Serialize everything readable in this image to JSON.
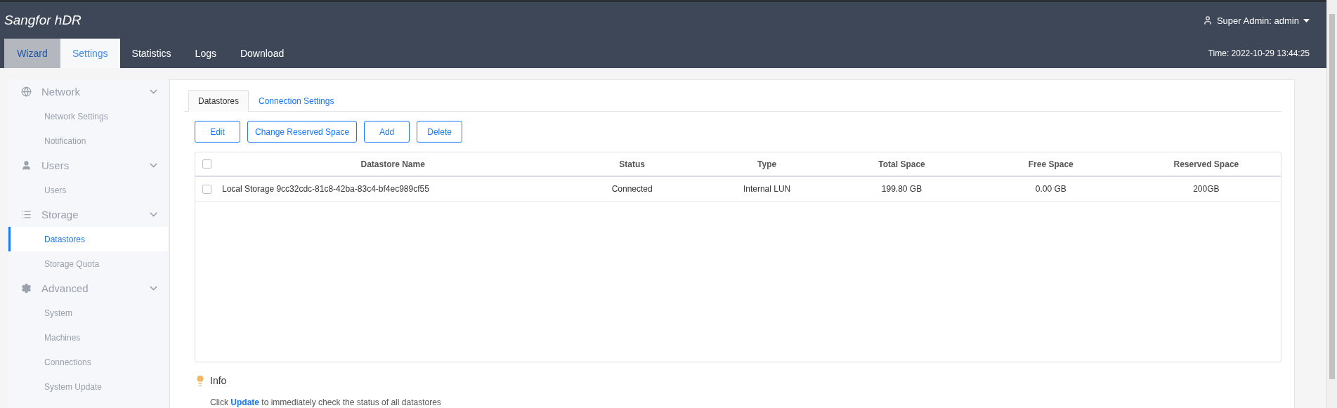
{
  "header": {
    "brand": "Sangfor hDR",
    "user": "Super Admin: admin",
    "time": "Time: 2022-10-29 13:44:25"
  },
  "nav_tabs": [
    {
      "label": "Wizard",
      "selected": false,
      "disabled": true
    },
    {
      "label": "Settings",
      "selected": true,
      "disabled": false
    },
    {
      "label": "Statistics",
      "selected": false,
      "disabled": false
    },
    {
      "label": "Logs",
      "selected": false,
      "disabled": false
    },
    {
      "label": "Download",
      "selected": false,
      "disabled": false
    }
  ],
  "sidebar": {
    "groups": [
      {
        "label": "Network",
        "expanded": true,
        "items": [
          {
            "label": "Network Settings",
            "selected": false
          },
          {
            "label": "Notification",
            "selected": false
          }
        ]
      },
      {
        "label": "Users",
        "expanded": true,
        "items": [
          {
            "label": "Users",
            "selected": false
          }
        ]
      },
      {
        "label": "Storage",
        "expanded": true,
        "items": [
          {
            "label": "Datastores",
            "selected": true
          },
          {
            "label": "Storage Quota",
            "selected": false
          }
        ]
      },
      {
        "label": "Advanced",
        "expanded": true,
        "items": [
          {
            "label": "System",
            "selected": false
          },
          {
            "label": "Machines",
            "selected": false
          },
          {
            "label": "Connections",
            "selected": false
          },
          {
            "label": "System Update",
            "selected": false
          }
        ]
      }
    ]
  },
  "content_tabs": [
    {
      "label": "Datastores",
      "selected": true
    },
    {
      "label": "Connection Settings",
      "selected": false
    }
  ],
  "buttons": [
    "Edit",
    "Change Reserved Space",
    "Add",
    "Delete"
  ],
  "table": {
    "select_all_checked": false,
    "columns": [
      "Datastore Name",
      "Status",
      "Type",
      "Total Space",
      "Free Space",
      "Reserved Space"
    ],
    "rows": [
      {
        "checked": false,
        "cells": [
          "Local Storage 9cc32cdc-81c8-42ba-83c4-bf4ec989cf55",
          "Connected",
          "Internal LUN",
          "199.80 GB",
          "0.00 GB",
          "200GB"
        ]
      }
    ]
  },
  "info": {
    "title": "Info",
    "text_before": "Click",
    "link": "Update",
    "text_after": "to immediately check the status of all datastores"
  }
}
